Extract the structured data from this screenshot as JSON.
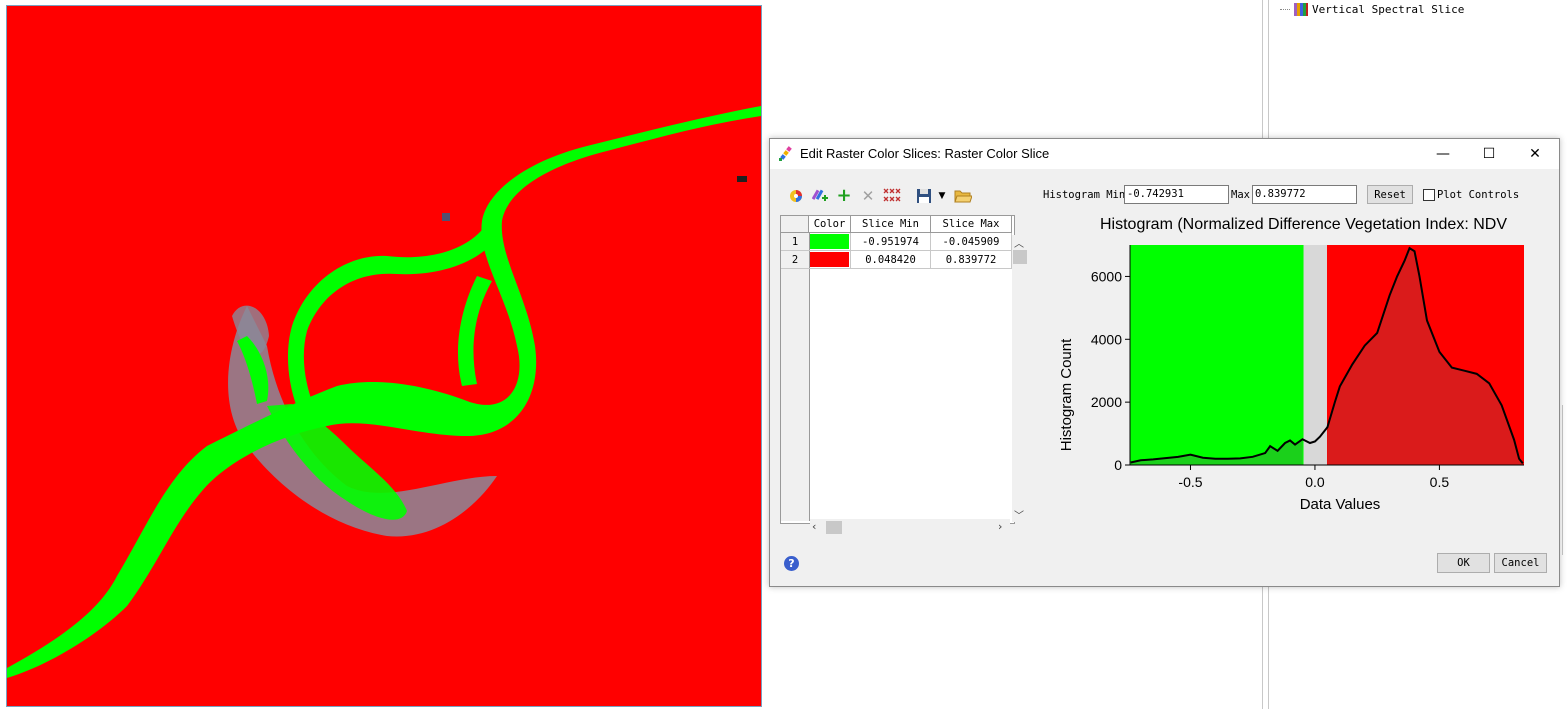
{
  "right_panel": {
    "tree_item_label": "Vertical Spectral Slice"
  },
  "dialog": {
    "title": "Edit Raster Color Slices: Raster Color Slice",
    "window_buttons": {
      "minimize": "—",
      "maximize": "☐",
      "close": "✕"
    },
    "toolbar_icons": [
      "color-wheel-icon",
      "add-slices-icon",
      "add-slice-icon",
      "delete-slice-icon",
      "delete-all-slices-icon",
      "save-icon",
      "open-folder-icon"
    ],
    "histogram_min_label": "Histogram Min",
    "histogram_min_value": "-0.742931",
    "max_label": "Max",
    "max_value": "0.839772",
    "reset_label": "Reset",
    "plot_controls_label": "Plot Controls",
    "table": {
      "columns": [
        "Color",
        "Slice Min",
        "Slice Max"
      ],
      "rows": [
        {
          "num": "1",
          "color": "#00ff00",
          "min": "-0.951974",
          "max": "-0.045909"
        },
        {
          "num": "2",
          "color": "#ff0000",
          "min": "0.048420",
          "max": "0.839772"
        }
      ]
    },
    "ok_label": "OK",
    "cancel_label": "Cancel",
    "help_label": "?"
  },
  "chart_data": {
    "type": "area",
    "title": "Histogram (Normalized Difference Vegetation Index: NDV",
    "xlabel": "Data Values",
    "ylabel": "Histogram Count",
    "xlim": [
      -0.742931,
      0.839772
    ],
    "ylim": [
      0,
      7000
    ],
    "x_ticks": [
      "-0.5",
      "0.0",
      "0.5"
    ],
    "x_tick_values": [
      -0.5,
      0.0,
      0.5
    ],
    "y_ticks": [
      "0",
      "2000",
      "4000",
      "6000"
    ],
    "y_tick_values": [
      0,
      2000,
      4000,
      6000
    ],
    "slices": [
      {
        "min": -0.951974,
        "max": -0.045909,
        "color": "#00ff00"
      },
      {
        "min": 0.04842,
        "max": 0.839772,
        "color": "#ff0000"
      }
    ],
    "series": [
      {
        "x": [
          -0.74,
          -0.7,
          -0.65,
          -0.6,
          -0.55,
          -0.5,
          -0.45,
          -0.4,
          -0.35,
          -0.3,
          -0.25,
          -0.2,
          -0.18,
          -0.15,
          -0.12,
          -0.1,
          -0.08,
          -0.05,
          -0.02,
          0.0,
          0.02,
          0.05,
          0.08,
          0.1,
          0.15,
          0.2,
          0.25,
          0.3,
          0.33,
          0.36,
          0.38,
          0.4,
          0.42,
          0.45,
          0.5,
          0.55,
          0.6,
          0.65,
          0.7,
          0.75,
          0.8,
          0.82,
          0.835
        ],
        "values": [
          80,
          150,
          180,
          220,
          260,
          330,
          230,
          200,
          200,
          210,
          260,
          380,
          600,
          450,
          700,
          780,
          650,
          820,
          700,
          750,
          900,
          1200,
          2000,
          2500,
          3200,
          3800,
          4200,
          5400,
          6000,
          6500,
          6900,
          6800,
          6000,
          4600,
          3600,
          3100,
          3000,
          2900,
          2600,
          1900,
          800,
          200,
          50
        ]
      }
    ]
  },
  "colors": {
    "map_background": "#ff0000",
    "water": "#00ff00",
    "nodata": "#808080"
  }
}
